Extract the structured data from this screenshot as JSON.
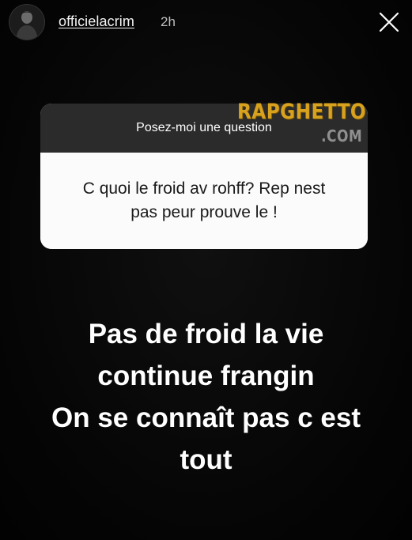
{
  "header": {
    "username": "officielacrim",
    "timestamp": "2h",
    "avatar_icon": "avatar-photo",
    "close_icon": "close-icon"
  },
  "question_sticker": {
    "prompt": "Posez-moi une question",
    "question": "C quoi le froid av rohff? Rep nest pas peur prouve le !"
  },
  "watermark": {
    "top": "RAPGHETTO",
    "bottom": ".COM",
    "color": "#d8a21e"
  },
  "answer": {
    "lines": [
      "Pas de froid la vie",
      "continue frangin",
      "On se connaît pas c est",
      "tout"
    ]
  }
}
